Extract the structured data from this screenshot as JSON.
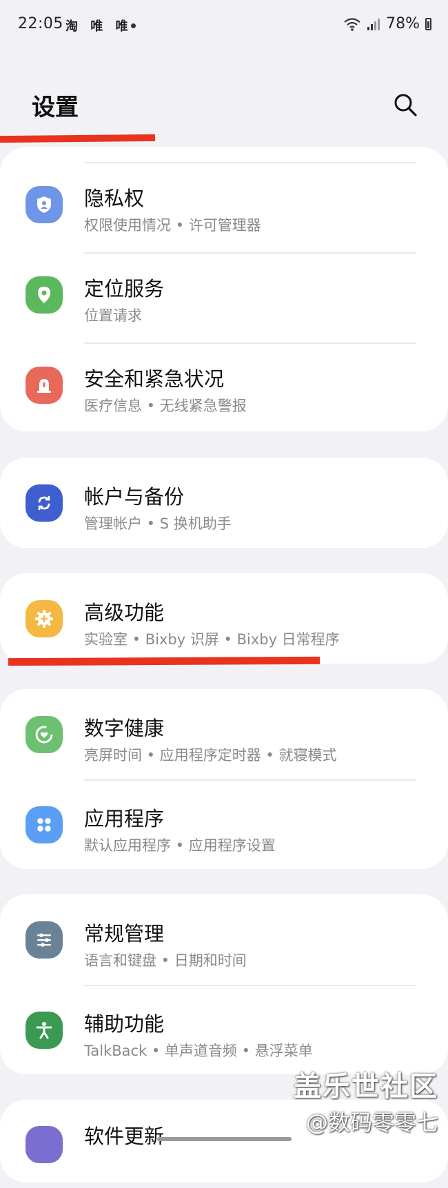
{
  "status_bar": {
    "time": "22:05",
    "app_icons": "淘 唯 唯",
    "battery": "78%"
  },
  "header": {
    "title": "设置",
    "search_icon": "search-icon"
  },
  "sections": [
    {
      "items": [
        {
          "label": "隐私权",
          "subtitle": "权限使用情况 • 许可管理器",
          "icon": "shield-person-icon",
          "color": "#6f95e8"
        },
        {
          "label": "定位服务",
          "subtitle": "位置请求",
          "icon": "location-pin-icon",
          "color": "#5cb85c"
        },
        {
          "label": "安全和紧急状况",
          "subtitle": "医疗信息 • 无线紧急警报",
          "icon": "emergency-siren-icon",
          "color": "#e8685a"
        }
      ]
    },
    {
      "items": [
        {
          "label": "帐户与备份",
          "subtitle": "管理帐户 • S 换机助手",
          "icon": "sync-icon",
          "color": "#3f5fd0"
        }
      ]
    },
    {
      "items": [
        {
          "label": "高级功能",
          "subtitle": "实验室 • Bixby 识屏 • Bixby 日常程序",
          "icon": "gear-plus-icon",
          "color": "#f5b843"
        }
      ]
    },
    {
      "items": [
        {
          "label": "数字健康",
          "subtitle": "亮屏时间 • 应用程序定时器 • 就寝模式",
          "icon": "heart-ring-icon",
          "color": "#6cc070"
        },
        {
          "label": "应用程序",
          "subtitle": "默认应用程序 • 应用程序设置",
          "icon": "apps-grid-icon",
          "color": "#5b9ff5"
        }
      ]
    },
    {
      "items": [
        {
          "label": "常规管理",
          "subtitle": "语言和键盘 • 日期和时间",
          "icon": "sliders-icon",
          "color": "#6b8295"
        },
        {
          "label": "辅助功能",
          "subtitle": "TalkBack • 单声道音频 • 悬浮菜单",
          "icon": "accessibility-icon",
          "color": "#3a9a52"
        }
      ]
    },
    {
      "items": [
        {
          "label": "软件更新",
          "subtitle": "",
          "icon": "software-update-icon",
          "color": "#7a6fd0"
        }
      ]
    }
  ],
  "watermark": {
    "line1": "盖乐世社区",
    "line2": "@数码零零七"
  },
  "accent_color": "#e8331f"
}
